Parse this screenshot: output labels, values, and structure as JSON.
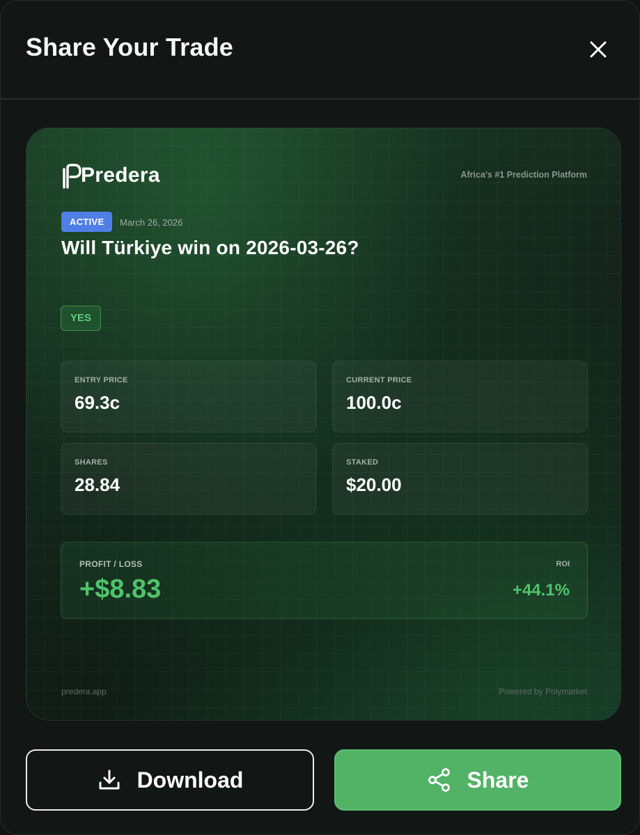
{
  "dialog": {
    "title": "Share Your Trade"
  },
  "card": {
    "brand": "Predera",
    "tagline": "Africa's #1 Prediction Platform",
    "status": "ACTIVE",
    "date": "March 26, 2026",
    "question": "Will Türkiye win on 2026-03-26?",
    "outcome": "YES",
    "stats": [
      {
        "label": "ENTRY PRICE",
        "value": "69.3c"
      },
      {
        "label": "CURRENT PRICE",
        "value": "100.0c"
      },
      {
        "label": "SHARES",
        "value": "28.84"
      },
      {
        "label": "STAKED",
        "value": "$20.00"
      }
    ],
    "profit_loss": {
      "label": "PROFIT / LOSS",
      "value": "+$8.83",
      "roi_label": "ROI",
      "roi_value": "+44.1%"
    },
    "footer_left": "predera.app",
    "footer_right": "Powered by Polymarket"
  },
  "actions": {
    "download_label": "Download",
    "share_label": "Share"
  },
  "colors": {
    "accent_green": "#52b266",
    "profit_green": "#4fc36a",
    "active_blue": "#4f7fe6"
  }
}
